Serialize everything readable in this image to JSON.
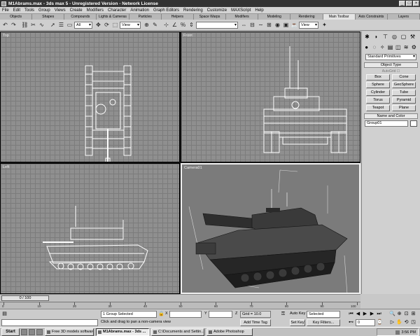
{
  "window": {
    "title": "M1Abrams.max - 3ds max 5 - Unregistered Version - Network License"
  },
  "menu": [
    "File",
    "Edit",
    "Tools",
    "Group",
    "Views",
    "Create",
    "Modifiers",
    "Character",
    "Animation",
    "Graph Editors",
    "Rendering",
    "Customize",
    "MAXScript",
    "Help"
  ],
  "tabs": [
    "Objects",
    "Shapes",
    "Compounds",
    "Lights & Cameras",
    "Particles",
    "Helpers",
    "Space Warps",
    "Modifiers",
    "Modeling",
    "Rendering",
    "Main Toolbar",
    "Axis Constraints",
    "Layers"
  ],
  "toolbar": {
    "selection_filter": "All",
    "ref_coord": "View",
    "named_selection": "",
    "render_type": "View"
  },
  "viewports": {
    "top": "Top",
    "front": "Front",
    "left": "Left",
    "camera": "Camera01"
  },
  "cmdpanel": {
    "category": "Standard Primitives",
    "object_type_header": "Object Type",
    "autogrid": "AutoGrid",
    "primitives": [
      "Box",
      "Cone",
      "Sphere",
      "GeoSphere",
      "Cylinder",
      "Tube",
      "Torus",
      "Pyramid",
      "Teapot",
      "Plane"
    ],
    "name_color_header": "Name and Color",
    "object_name": "Group01",
    "object_color": "#ffffff"
  },
  "time": {
    "slider": "0 / 100",
    "ticks": [
      "0",
      "10",
      "20",
      "30",
      "40",
      "50",
      "60",
      "70",
      "80",
      "90",
      "100"
    ]
  },
  "status": {
    "selection": "1 Group Selected",
    "prompt": "Click and drag to pan a non-camera view",
    "x_label": "X",
    "y_label": "Y",
    "z_label": "Z",
    "grid": "Grid = 10.0",
    "add_time_tag": "Add Time Tag",
    "auto_key": "Auto Key",
    "set_key": "Set Key",
    "key_mode": "Selected",
    "key_filters": "Key Filters...",
    "frame": "0"
  },
  "taskbar": {
    "start": "Start",
    "tasks": [
      "Free 3D models software...",
      "M1Abrams.max - 3ds ...",
      "C:\\Documents and Settin...",
      "Adobe Photoshop"
    ],
    "clock": "3:56 PM"
  }
}
